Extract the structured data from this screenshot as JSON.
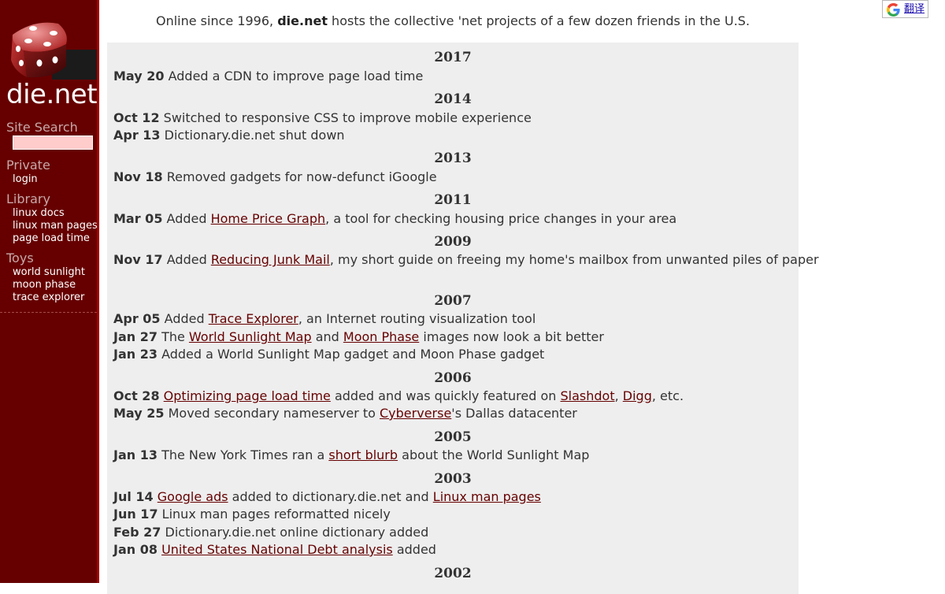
{
  "sidebar": {
    "logo_text": "die.net",
    "search_heading": "Site Search",
    "private_heading": "Private",
    "private_links": [
      "login"
    ],
    "library_heading": "Library",
    "library_links": [
      "linux docs",
      "linux man pages",
      "page load time"
    ],
    "toys_heading": "Toys",
    "toys_links": [
      "world sunlight",
      "moon phase",
      "trace explorer"
    ]
  },
  "intro": {
    "before": "Online since 1996, ",
    "brand": "die.net",
    "after": " hosts the collective 'net projects of a few dozen friends in the U.S."
  },
  "translate": {
    "label": "翻译"
  },
  "news": {
    "y2017": "2017",
    "e2017_1": {
      "date": "May 20",
      "text": "Added a CDN to improve page load time"
    },
    "y2014": "2014",
    "e2014_1": {
      "date": "Oct 12",
      "text": "Switched to responsive CSS to improve mobile experience"
    },
    "e2014_2": {
      "date": "Apr 13",
      "text": "Dictionary.die.net shut down"
    },
    "y2013": "2013",
    "e2013_1": {
      "date": "Nov 18",
      "text": "Removed gadgets for now-defunct iGoogle"
    },
    "y2011": "2011",
    "e2011_1": {
      "date": "Mar 05",
      "t1": "Added ",
      "link1": "Home Price Graph",
      "t2": ", a tool for checking housing price changes in your area"
    },
    "y2009": "2009",
    "e2009_1": {
      "date": "Nov 17",
      "t1": "Added ",
      "link1": "Reducing Junk Mail",
      "t2": ", my short guide on freeing my home's mailbox from unwanted piles of paper"
    },
    "y2007": "2007",
    "e2007_1": {
      "date": "Apr 05",
      "t1": "Added ",
      "link1": "Trace Explorer",
      "t2": ", an Internet routing visualization tool"
    },
    "e2007_2": {
      "date": "Jan 27",
      "t1": "The ",
      "link1": "World Sunlight Map",
      "t2": " and ",
      "link2": "Moon Phase",
      "t3": " images now look a bit better"
    },
    "e2007_3": {
      "date": "Jan 23",
      "text": "Added a World Sunlight Map gadget and Moon Phase gadget"
    },
    "y2006": "2006",
    "e2006_1": {
      "date": "Oct 28",
      "link1": "Optimizing page load time",
      "t1": " added and was quickly featured on ",
      "link2": "Slashdot",
      "t2": ", ",
      "link3": "Digg",
      "t3": ", etc."
    },
    "e2006_2": {
      "date": "May 25",
      "t1": "Moved secondary nameserver to ",
      "link1": "Cyberverse",
      "t2": "'s Dallas datacenter"
    },
    "y2005": "2005",
    "e2005_1": {
      "date": "Jan 13",
      "t1": "The New York Times ran a ",
      "link1": "short blurb",
      "t2": " about the World Sunlight Map"
    },
    "y2003": "2003",
    "e2003_1": {
      "date": "Jul 14",
      "link1": "Google ads",
      "t1": " added to dictionary.die.net and ",
      "link2": "Linux man pages"
    },
    "e2003_2": {
      "date": "Jun 17",
      "text": "Linux man pages reformatted nicely"
    },
    "e2003_3": {
      "date": "Feb 27",
      "text": "Dictionary.die.net online dictionary added"
    },
    "e2003_4": {
      "date": "Jan 08",
      "link1": "United States National Debt analysis",
      "t1": " added"
    },
    "y2002": "2002"
  },
  "colors": {
    "sidebar_bg": "#660000",
    "sidebar_border": "#a00000",
    "panel_bg": "#eeeeee",
    "link": "#660000",
    "search_input_bg": "#ffcccc"
  }
}
